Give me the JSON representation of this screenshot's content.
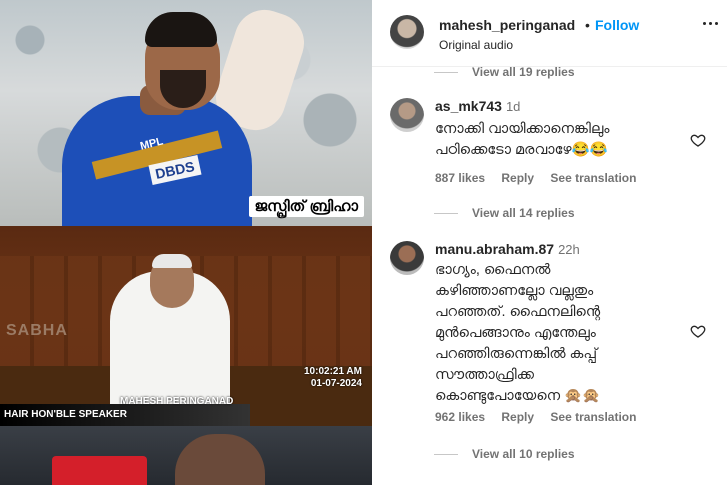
{
  "media": {
    "panel1_caption": "ജസ്പ്രിത് ബ്രിഹാ",
    "panel1_jersey_text": "DBDS",
    "panel1_sponsor": "MPL",
    "panel2_watermark": "SABHA",
    "panel2_time": "10:02:21 AM",
    "panel2_date": "01-07-2024",
    "panel2_credit": "MAHESH PERINGANAD",
    "panel2_ticker": "HAIR HON'BLE SPEAKER"
  },
  "header": {
    "username": "mahesh_peringanad",
    "dot": "•",
    "follow_label": "Follow",
    "audio": "Original audio"
  },
  "top_view_replies": "View all 19 replies",
  "comments": [
    {
      "username": "as_mk743",
      "time": "1d",
      "text": "നോക്കി വായിക്കാനെങ്കിലും\nപഠിക്കെടോ മരവാഴേ😂😂",
      "likes": "887 likes",
      "reply": "Reply",
      "translate": "See translation",
      "view_replies": "View all 14 replies"
    },
    {
      "username": "manu.abraham.87",
      "time": "22h",
      "text": "ഭാഗ്യം, ഫൈനൽ\nകഴിഞ്ഞാണല്ലോ വല്ലതും\nപറഞ്ഞത്. ഫൈനലിന്റെ\nമുൻപെങ്ങാനും എന്തേലും\nപറഞ്ഞിരുന്നെങ്കിൽ കപ്പ്\nസൗത്താഫ്രിക്ക\nകൊണ്ടുപോയേനെ 🙊🙊",
      "likes": "962 likes",
      "reply": "Reply",
      "translate": "See translation",
      "view_replies": "View all 10 replies"
    }
  ],
  "icons": {
    "more": "more-options-icon",
    "heart": "heart-outline-icon"
  }
}
